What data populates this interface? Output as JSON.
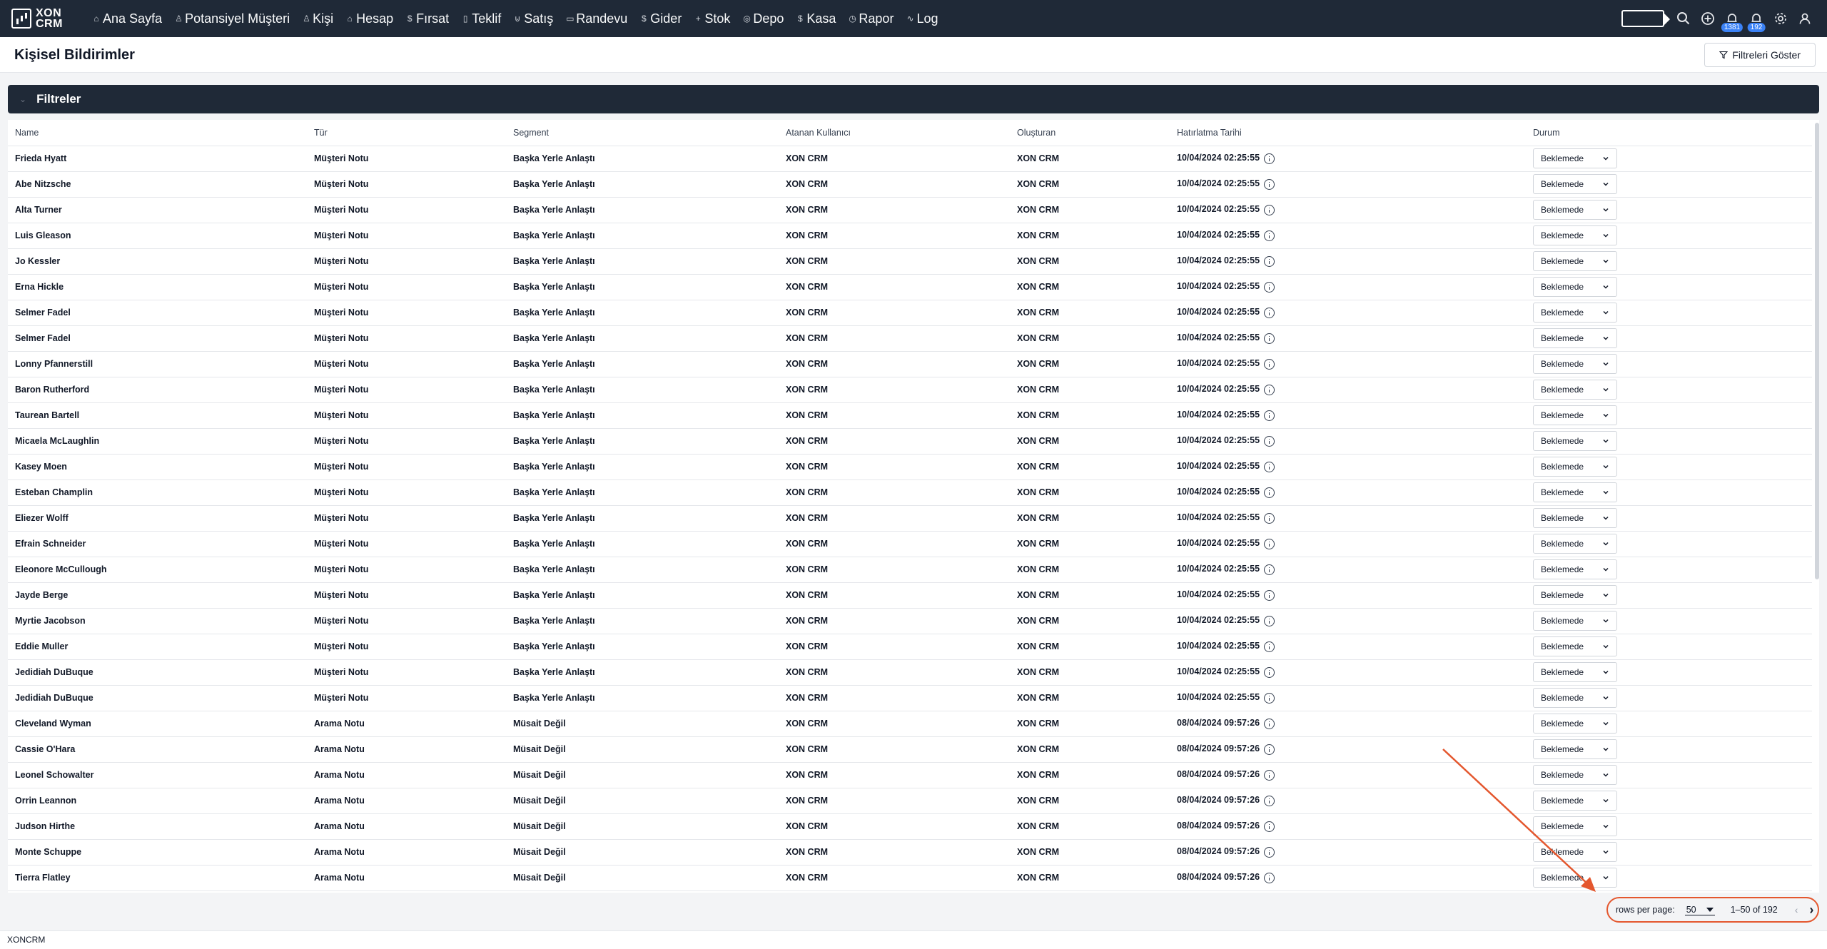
{
  "app": {
    "logo_text_1": "XON",
    "logo_text_2": "CRM"
  },
  "nav": {
    "items": [
      {
        "label": "Ana Sayfa",
        "icon": "home-icon",
        "glyph": "⌂"
      },
      {
        "label": "Potansiyel Müşteri",
        "icon": "person-icon",
        "glyph": "♙"
      },
      {
        "label": "Kişi",
        "icon": "people-icon",
        "glyph": "♙"
      },
      {
        "label": "Hesap",
        "icon": "building-icon",
        "glyph": "⌂"
      },
      {
        "label": "Fırsat",
        "icon": "dollar-icon",
        "glyph": "$"
      },
      {
        "label": "Teklif",
        "icon": "document-icon",
        "glyph": "▯"
      },
      {
        "label": "Satış",
        "icon": "cart-icon",
        "glyph": "⊍"
      },
      {
        "label": "Randevu",
        "icon": "calendar-icon",
        "glyph": "▭"
      },
      {
        "label": "Gider",
        "icon": "dollar-icon",
        "glyph": "$"
      },
      {
        "label": "Stok",
        "icon": "plus-icon",
        "glyph": "+"
      },
      {
        "label": "Depo",
        "icon": "box-icon",
        "glyph": "◎"
      },
      {
        "label": "Kasa",
        "icon": "dollar-icon",
        "glyph": "$"
      },
      {
        "label": "Rapor",
        "icon": "clock-icon",
        "glyph": "◷"
      },
      {
        "label": "Log",
        "icon": "activity-icon",
        "glyph": "∿"
      }
    ],
    "badges": {
      "notifications": "1381",
      "messages": "192"
    }
  },
  "page": {
    "title": "Kişisel Bildirimler",
    "filters_button": "Filtreleri Göster"
  },
  "filters": {
    "title": "Filtreler"
  },
  "table": {
    "headers": [
      "Name",
      "Tür",
      "Segment",
      "Atanan Kullanıcı",
      "Oluşturan",
      "Hatırlatma Tarihi",
      "Durum"
    ],
    "rows": [
      [
        "Frieda Hyatt",
        "Müşteri Notu",
        "Başka Yerle Anlaştı",
        "XON CRM",
        "XON CRM",
        "10/04/2024 02:25:55",
        "Beklemede"
      ],
      [
        "Abe Nitzsche",
        "Müşteri Notu",
        "Başka Yerle Anlaştı",
        "XON CRM",
        "XON CRM",
        "10/04/2024 02:25:55",
        "Beklemede"
      ],
      [
        "Alta Turner",
        "Müşteri Notu",
        "Başka Yerle Anlaştı",
        "XON CRM",
        "XON CRM",
        "10/04/2024 02:25:55",
        "Beklemede"
      ],
      [
        "Luis Gleason",
        "Müşteri Notu",
        "Başka Yerle Anlaştı",
        "XON CRM",
        "XON CRM",
        "10/04/2024 02:25:55",
        "Beklemede"
      ],
      [
        "Jo Kessler",
        "Müşteri Notu",
        "Başka Yerle Anlaştı",
        "XON CRM",
        "XON CRM",
        "10/04/2024 02:25:55",
        "Beklemede"
      ],
      [
        "Erna Hickle",
        "Müşteri Notu",
        "Başka Yerle Anlaştı",
        "XON CRM",
        "XON CRM",
        "10/04/2024 02:25:55",
        "Beklemede"
      ],
      [
        "Selmer Fadel",
        "Müşteri Notu",
        "Başka Yerle Anlaştı",
        "XON CRM",
        "XON CRM",
        "10/04/2024 02:25:55",
        "Beklemede"
      ],
      [
        "Selmer Fadel",
        "Müşteri Notu",
        "Başka Yerle Anlaştı",
        "XON CRM",
        "XON CRM",
        "10/04/2024 02:25:55",
        "Beklemede"
      ],
      [
        "Lonny Pfannerstill",
        "Müşteri Notu",
        "Başka Yerle Anlaştı",
        "XON CRM",
        "XON CRM",
        "10/04/2024 02:25:55",
        "Beklemede"
      ],
      [
        "Baron Rutherford",
        "Müşteri Notu",
        "Başka Yerle Anlaştı",
        "XON CRM",
        "XON CRM",
        "10/04/2024 02:25:55",
        "Beklemede"
      ],
      [
        "Taurean Bartell",
        "Müşteri Notu",
        "Başka Yerle Anlaştı",
        "XON CRM",
        "XON CRM",
        "10/04/2024 02:25:55",
        "Beklemede"
      ],
      [
        "Micaela McLaughlin",
        "Müşteri Notu",
        "Başka Yerle Anlaştı",
        "XON CRM",
        "XON CRM",
        "10/04/2024 02:25:55",
        "Beklemede"
      ],
      [
        "Kasey Moen",
        "Müşteri Notu",
        "Başka Yerle Anlaştı",
        "XON CRM",
        "XON CRM",
        "10/04/2024 02:25:55",
        "Beklemede"
      ],
      [
        "Esteban Champlin",
        "Müşteri Notu",
        "Başka Yerle Anlaştı",
        "XON CRM",
        "XON CRM",
        "10/04/2024 02:25:55",
        "Beklemede"
      ],
      [
        "Eliezer Wolff",
        "Müşteri Notu",
        "Başka Yerle Anlaştı",
        "XON CRM",
        "XON CRM",
        "10/04/2024 02:25:55",
        "Beklemede"
      ],
      [
        "Efrain Schneider",
        "Müşteri Notu",
        "Başka Yerle Anlaştı",
        "XON CRM",
        "XON CRM",
        "10/04/2024 02:25:55",
        "Beklemede"
      ],
      [
        "Eleonore McCullough",
        "Müşteri Notu",
        "Başka Yerle Anlaştı",
        "XON CRM",
        "XON CRM",
        "10/04/2024 02:25:55",
        "Beklemede"
      ],
      [
        "Jayde Berge",
        "Müşteri Notu",
        "Başka Yerle Anlaştı",
        "XON CRM",
        "XON CRM",
        "10/04/2024 02:25:55",
        "Beklemede"
      ],
      [
        "Myrtie Jacobson",
        "Müşteri Notu",
        "Başka Yerle Anlaştı",
        "XON CRM",
        "XON CRM",
        "10/04/2024 02:25:55",
        "Beklemede"
      ],
      [
        "Eddie Muller",
        "Müşteri Notu",
        "Başka Yerle Anlaştı",
        "XON CRM",
        "XON CRM",
        "10/04/2024 02:25:55",
        "Beklemede"
      ],
      [
        "Jedidiah DuBuque",
        "Müşteri Notu",
        "Başka Yerle Anlaştı",
        "XON CRM",
        "XON CRM",
        "10/04/2024 02:25:55",
        "Beklemede"
      ],
      [
        "Jedidiah DuBuque",
        "Müşteri Notu",
        "Başka Yerle Anlaştı",
        "XON CRM",
        "XON CRM",
        "10/04/2024 02:25:55",
        "Beklemede"
      ],
      [
        "Cleveland Wyman",
        "Arama Notu",
        "Müsait Değil",
        "XON CRM",
        "XON CRM",
        "08/04/2024 09:57:26",
        "Beklemede"
      ],
      [
        "Cassie O'Hara",
        "Arama Notu",
        "Müsait Değil",
        "XON CRM",
        "XON CRM",
        "08/04/2024 09:57:26",
        "Beklemede"
      ],
      [
        "Leonel Schowalter",
        "Arama Notu",
        "Müsait Değil",
        "XON CRM",
        "XON CRM",
        "08/04/2024 09:57:26",
        "Beklemede"
      ],
      [
        "Orrin Leannon",
        "Arama Notu",
        "Müsait Değil",
        "XON CRM",
        "XON CRM",
        "08/04/2024 09:57:26",
        "Beklemede"
      ],
      [
        "Judson Hirthe",
        "Arama Notu",
        "Müsait Değil",
        "XON CRM",
        "XON CRM",
        "08/04/2024 09:57:26",
        "Beklemede"
      ],
      [
        "Monte Schuppe",
        "Arama Notu",
        "Müsait Değil",
        "XON CRM",
        "XON CRM",
        "08/04/2024 09:57:26",
        "Beklemede"
      ],
      [
        "Tierra Flatley",
        "Arama Notu",
        "Müsait Değil",
        "XON CRM",
        "XON CRM",
        "08/04/2024 09:57:26",
        "Beklemede"
      ]
    ]
  },
  "pagination": {
    "rows_per_page_label": "rows per page:",
    "rows_per_page": "50",
    "range": "1–50 of 192",
    "prev_glyph": "‹",
    "next_glyph": "›"
  },
  "footer": {
    "text": "XONCRM"
  },
  "colors": {
    "nav_bg": "#1f2937",
    "annotation": "#e4572e",
    "badge": "#3b82f6"
  }
}
